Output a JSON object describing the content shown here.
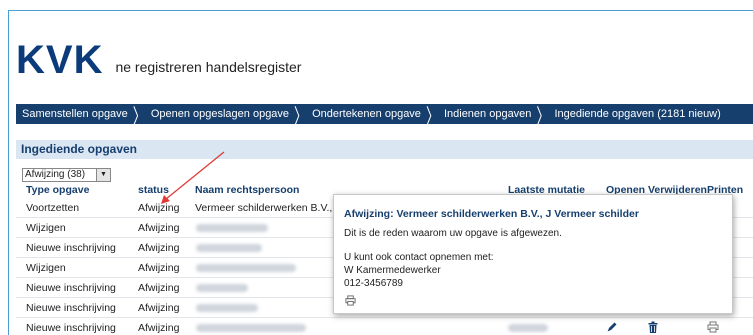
{
  "brand": {
    "logo": "KVK",
    "tagline": "ne registreren handelsregister"
  },
  "nav": [
    "Samenstellen opgave",
    "Openen opgeslagen opgave",
    "Ondertekenen opgave",
    "Indienen opgaven",
    "Ingediende opgaven (2181 nieuw)"
  ],
  "section_title": "Ingediende opgaven",
  "filter": {
    "value": "Afwijzing (38)"
  },
  "columns": {
    "type": "Type opgave",
    "status": "status",
    "name": "Naam rechtspersoon",
    "mutation": "Laatste mutatie",
    "open": "Openen",
    "delete": "Verwijderen",
    "print": "Printen"
  },
  "rows": [
    {
      "type": "Voortzetten",
      "status": "Afwijzing",
      "name": "Vermeer schilderwerken B.V., J V"
    },
    {
      "type": "Wijzigen",
      "status": "Afwijzing"
    },
    {
      "type": "Nieuwe inschrijving",
      "status": "Afwijzing"
    },
    {
      "type": "Wijzigen",
      "status": "Afwijzing"
    },
    {
      "type": "Nieuwe inschrijving",
      "status": "Afwijzing"
    },
    {
      "type": "Nieuwe inschrijving",
      "status": "Afwijzing"
    },
    {
      "type": "Nieuwe inschrijving",
      "status": "Afwijzing"
    }
  ],
  "popup": {
    "title": "Afwijzing: Vermeer schilderwerken B.V., J Vermeer schilder",
    "reason": "Dit is de reden waarom uw opgave is afgewezen.",
    "contact_intro": "U kunt ook contact opnemen met:",
    "contact_name": "W Kamermedewerker",
    "contact_phone": "012-3456789"
  },
  "colors": {
    "brand": "#0b3b7a",
    "navbar": "#163f6e",
    "section": "#dbe6f3",
    "annotation_arrow": "#e03a3a"
  },
  "icons": [
    "edit-icon",
    "trash-icon",
    "print-icon",
    "dropdown-arrow-icon"
  ]
}
